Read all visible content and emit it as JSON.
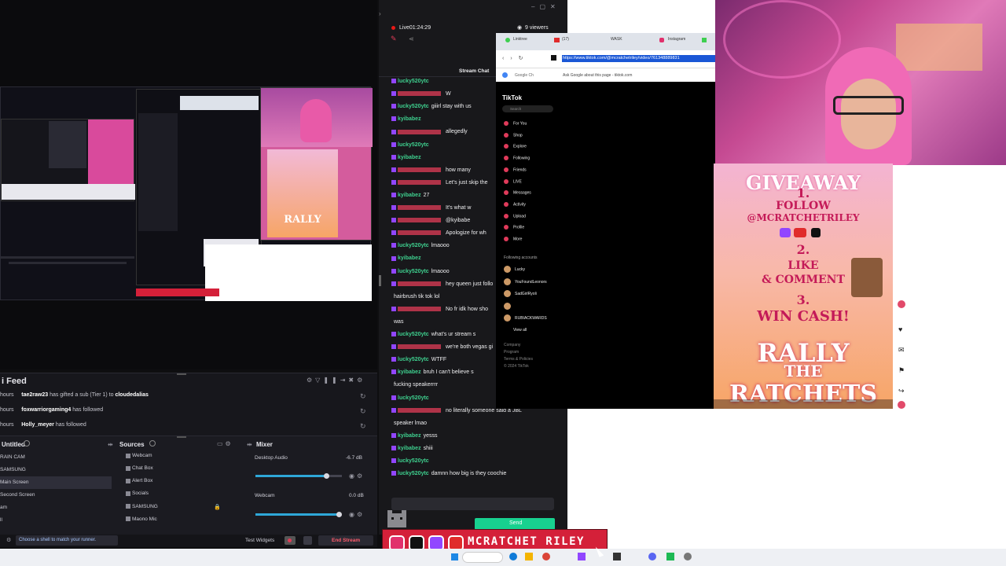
{
  "obs": {
    "activity_feed": {
      "title": "i Feed",
      "rows": [
        {
          "time": "hours",
          "user": "tae2raw23",
          "action": "has gifted a sub (Tier 1) to",
          "target": "cloudedalias"
        },
        {
          "time": "hours",
          "user": "foxwarriorgaming4",
          "action": "has followed",
          "target": ""
        },
        {
          "time": "hours",
          "user": "Holly_meyer",
          "action": "has followed",
          "target": ""
        }
      ]
    },
    "scenes": {
      "title": "Untitled",
      "items": [
        "RAIN CAM",
        "SAMSUNG",
        "Main Screen",
        "Second Screen",
        "am",
        "ll"
      ],
      "active_index": 2
    },
    "sources": {
      "title": "Sources",
      "items": [
        "Webcam",
        "Chat Box",
        "Alert Box",
        "Socials",
        "SAMSUNG",
        "Maono Mic"
      ]
    },
    "mixer": {
      "title": "Mixer",
      "channels": [
        {
          "name": "Desktop Audio",
          "db": "-6.7 dB",
          "level": 0.82
        },
        {
          "name": "Webcam",
          "db": "0.0 dB",
          "level": 0.96
        }
      ]
    },
    "status": {
      "hint": "Choose a shell to match your runner.",
      "test_widgets": "Test Widgets",
      "end_stream": "End Stream"
    }
  },
  "chat": {
    "live_label": "Live",
    "live_time": "01:24:29",
    "viewers": "9 viewers",
    "header": "Stream Chat",
    "messages": [
      {
        "user": "lucky520ytc",
        "color": "#3ecf8e",
        "text": ""
      },
      {
        "user": "",
        "color": "#e23c58",
        "text": "W"
      },
      {
        "user": "lucky520ytc",
        "color": "#3ecf8e",
        "text": "giiirl stay with us"
      },
      {
        "user": "kyibabez",
        "color": "#3ecf8e",
        "text": ""
      },
      {
        "user": "",
        "color": "#e23c58",
        "text": "allegedly"
      },
      {
        "user": "lucky520ytc",
        "color": "#3ecf8e",
        "text": ""
      },
      {
        "user": "kyibabez",
        "color": "#3ecf8e",
        "text": ""
      },
      {
        "user": "",
        "color": "#e23c58",
        "text": "how many"
      },
      {
        "user": "",
        "color": "#e23c58",
        "text": "Let's just skip the"
      },
      {
        "user": "kyibabez",
        "color": "#3ecf8e",
        "text": "27"
      },
      {
        "user": "",
        "color": "#e23c58",
        "text": "It's what w"
      },
      {
        "user": "",
        "color": "#e23c58",
        "text": "@kyibabe"
      },
      {
        "user": "",
        "color": "#e23c58",
        "text": "Apologize for wh"
      },
      {
        "user": "lucky520ytc",
        "color": "#3ecf8e",
        "text": "lmaooo"
      },
      {
        "user": "kyibabez",
        "color": "#3ecf8e",
        "text": ""
      },
      {
        "user": "lucky520ytc",
        "color": "#3ecf8e",
        "text": "lmaooo"
      },
      {
        "user": "",
        "color": "#e23c58",
        "text": "hey queen just follo"
      },
      {
        "user": "",
        "color": "#efeff1",
        "text": "hairbrush tik tok lol"
      },
      {
        "user": "",
        "color": "#e23c58",
        "text": "No fr idk how sho"
      },
      {
        "user": "",
        "color": "#efeff1",
        "text": "was"
      },
      {
        "user": "lucky520ytc",
        "color": "#3ecf8e",
        "text": "what's ur stream s"
      },
      {
        "user": "",
        "color": "#e23c58",
        "text": "we're both vegas gi"
      },
      {
        "user": "lucky520ytc",
        "color": "#3ecf8e",
        "text": "WTFF"
      },
      {
        "user": "kyibabez",
        "color": "#3ecf8e",
        "text": "bruh I can't believe s"
      },
      {
        "user": "",
        "color": "#efeff1",
        "text": "fucking speakerrrr"
      },
      {
        "user": "lucky520ytc",
        "color": "#3ecf8e",
        "text": ""
      },
      {
        "user": "",
        "color": "#e23c58",
        "text": "no literally someone said a JBL"
      },
      {
        "user": "",
        "color": "#efeff1",
        "text": "speaker lmao"
      },
      {
        "user": "kyibabez",
        "color": "#3ecf8e",
        "text": "yesss"
      },
      {
        "user": "kyibabez",
        "color": "#3ecf8e",
        "text": "shiii"
      },
      {
        "user": "lucky520ytc",
        "color": "#3ecf8e",
        "text": ""
      },
      {
        "user": "lucky520ytc",
        "color": "#3ecf8e",
        "text": "damnn how big is they coochie"
      }
    ],
    "send_label": "Send"
  },
  "browser": {
    "tabs": [
      "Linktree",
      "(17)",
      "WASK",
      "Instagram"
    ],
    "url": "https://www.tiktok.com/@mcratchetriley/video/761348889831",
    "suggestion": "Ask Google about this page - tiktok.com",
    "google_label": "Google Ch",
    "tiktok": {
      "logo": "TikTok",
      "search": "Search",
      "nav": [
        "For You",
        "Shop",
        "Explore",
        "Following",
        "Friends",
        "LIVE",
        "Messages",
        "Activity",
        "Upload",
        "Profile",
        "More"
      ],
      "following_header": "Following accounts",
      "accounts": [
        "Lucky",
        "YouFoundLeonors",
        "SadGirlRyoli",
        "",
        "RUBIACKWARDS"
      ],
      "view_all": "View all",
      "footer": [
        "Company",
        "Program",
        "Terms & Policies",
        "© 2024 TikTok"
      ]
    }
  },
  "poster": {
    "giveaway": "GIVEAWAY",
    "step1": "1.",
    "follow": "FOLLOW",
    "handle": "@MCRATCHETRILEY",
    "step2": "2.",
    "like": "LIKE",
    "comment": "& COMMENT",
    "step3": "3.",
    "win": "WIN CASH!",
    "rally": "RALLY",
    "the": "THE",
    "ratchets": "RATCHETS"
  },
  "banner": {
    "name": "MCRATCHET RILEY",
    "icons": [
      "instagram-icon",
      "tiktok-icon",
      "twitch-icon",
      "youtube-icon"
    ]
  },
  "colors": {
    "twitch_purple": "#9146ff",
    "green_user": "#3ecf8e",
    "red_user": "#e23c58",
    "banner_red": "#d42039"
  }
}
